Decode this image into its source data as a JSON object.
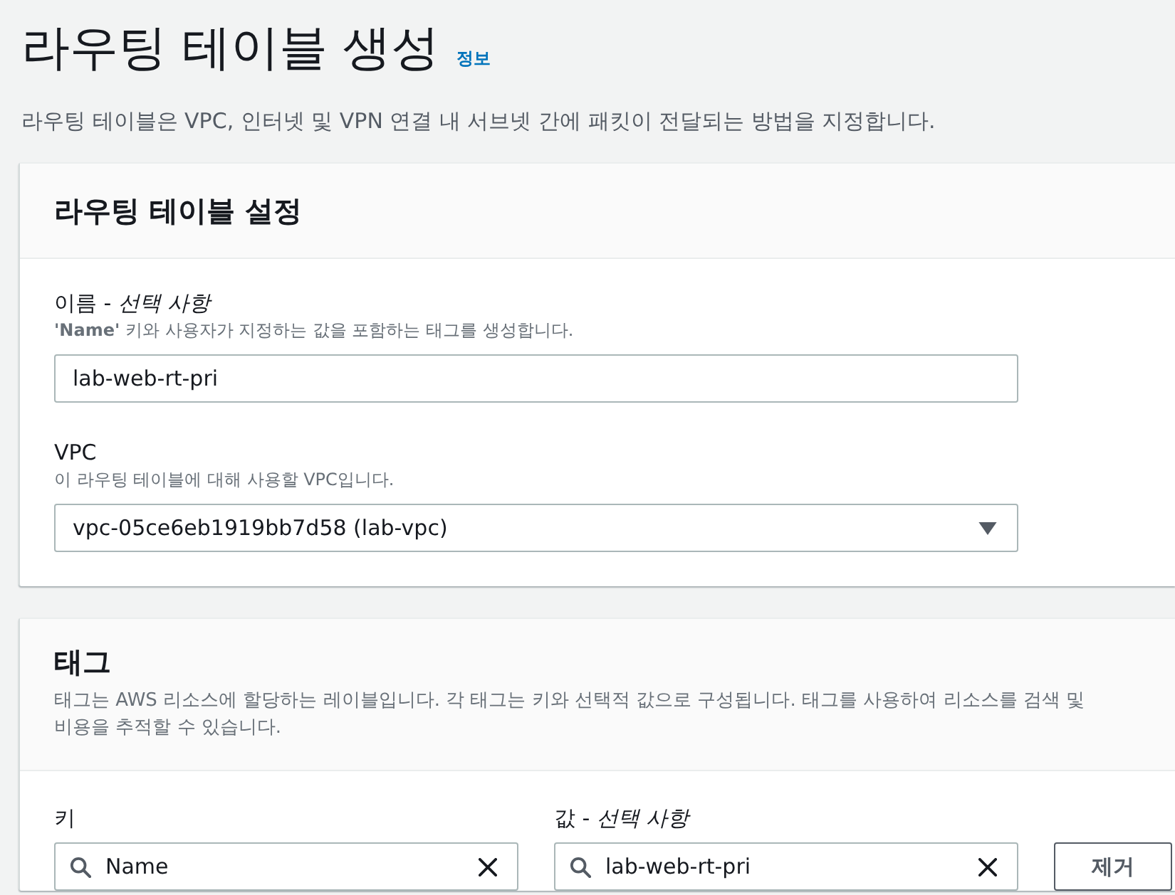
{
  "page": {
    "title": "라우팅 테이블 생성",
    "info_link": "정보",
    "description": "라우팅 테이블은 VPC, 인터넷 및 VPN 연결 내 서브넷 간에 패킷이 전달되는 방법을 지정합니다."
  },
  "settings_panel": {
    "title": "라우팅 테이블 설정",
    "fields": [
      {
        "kind": "text",
        "label": "이름 - *선택 사항*",
        "hint": "**'Name'** 키와 사용자가 지정하는 값을 포함하는 태그를 생성합니다.",
        "value": "lab-web-rt-pri"
      },
      {
        "kind": "select",
        "label": "VPC",
        "hint": "이 라우팅 테이블에 대해 사용할 VPC입니다.",
        "value": "vpc-05ce6eb1919bb7d58 (lab-vpc)"
      }
    ]
  },
  "tags_panel": {
    "title": "태그",
    "description_lines": [
      "태그는 AWS 리소스에 할당하는 레이블입니다. 각 태그는 키와 선택적 값으로 구성됩니다. 태그를 사용하여 리소스를 검색 및",
      "비용을 추적할 수 있습니다."
    ],
    "columns": [
      {
        "label": "키"
      },
      {
        "label": "값 - *선택 사항*"
      }
    ],
    "tags": [
      {
        "key": "Name",
        "value": "lab-web-rt-pri",
        "remove_button": "제거"
      }
    ]
  }
}
